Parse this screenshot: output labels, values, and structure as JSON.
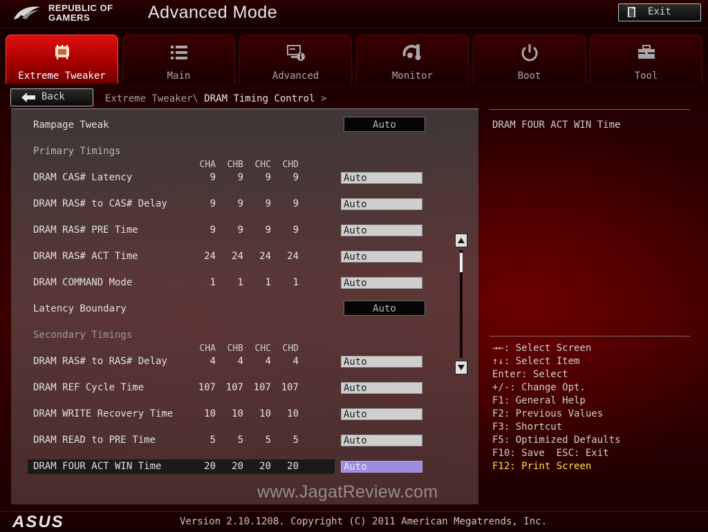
{
  "header": {
    "brand_line1": "REPUBLIC OF",
    "brand_line2": "GAMERS",
    "title": "Advanced Mode",
    "exit_label": "Exit"
  },
  "tabs": [
    {
      "label": "Extreme Tweaker",
      "icon": "extreme-tweaker-icon",
      "active": true
    },
    {
      "label": "Main",
      "icon": "list-icon",
      "active": false
    },
    {
      "label": "Advanced",
      "icon": "advanced-settings-icon",
      "active": false
    },
    {
      "label": "Monitor",
      "icon": "monitor-thermometer-icon",
      "active": false
    },
    {
      "label": "Boot",
      "icon": "power-icon",
      "active": false
    },
    {
      "label": "Tool",
      "icon": "toolbox-icon",
      "active": false
    }
  ],
  "nav": {
    "back_label": "Back",
    "breadcrumb_parent": "Extreme Tweaker\\",
    "breadcrumb_current": "DRAM Timing Control",
    "breadcrumb_arrow": ">"
  },
  "settings": {
    "rampage_tweak": {
      "label": "Rampage Tweak",
      "value": "Auto"
    },
    "primary_header": "Primary Timings",
    "channels": [
      "CHA",
      "CHB",
      "CHC",
      "CHD"
    ],
    "primary_rows": [
      {
        "label": "DRAM CAS# Latency",
        "values": [
          "9",
          "9",
          "9",
          "9"
        ],
        "setting": "Auto"
      },
      {
        "label": "DRAM RAS# to CAS# Delay",
        "values": [
          "9",
          "9",
          "9",
          "9"
        ],
        "setting": "Auto"
      },
      {
        "label": "DRAM RAS# PRE Time",
        "values": [
          "9",
          "9",
          "9",
          "9"
        ],
        "setting": "Auto"
      },
      {
        "label": "DRAM RAS# ACT Time",
        "values": [
          "24",
          "24",
          "24",
          "24"
        ],
        "setting": "Auto"
      },
      {
        "label": "DRAM COMMAND Mode",
        "values": [
          "1",
          "1",
          "1",
          "1"
        ],
        "setting": "Auto"
      }
    ],
    "latency_boundary": {
      "label": "Latency Boundary",
      "value": "Auto"
    },
    "secondary_header": "Secondary Timings",
    "secondary_rows": [
      {
        "label": "DRAM RAS# to RAS# Delay",
        "values": [
          "4",
          "4",
          "4",
          "4"
        ],
        "setting": "Auto"
      },
      {
        "label": "DRAM REF Cycle Time",
        "values": [
          "107",
          "107",
          "107",
          "107"
        ],
        "setting": "Auto"
      },
      {
        "label": "DRAM WRITE Recovery Time",
        "values": [
          "10",
          "10",
          "10",
          "10"
        ],
        "setting": "Auto"
      },
      {
        "label": "DRAM READ to PRE Time",
        "values": [
          "5",
          "5",
          "5",
          "5"
        ],
        "setting": "Auto"
      },
      {
        "label": "DRAM FOUR ACT WIN Time",
        "values": [
          "20",
          "20",
          "20",
          "20"
        ],
        "setting": "Auto",
        "selected": true
      }
    ]
  },
  "help": {
    "description": "DRAM FOUR ACT WIN Time",
    "keys": [
      "→←: Select Screen",
      "↑↓: Select Item",
      "Enter: Select",
      "+/-: Change Opt.",
      "F1: General Help",
      "F2: Previous Values",
      "F3: Shortcut",
      "F5: Optimized Defaults",
      "F10: Save  ESC: Exit",
      "F12: Print Screen"
    ]
  },
  "watermark": "www.JagatReview.com",
  "footer": {
    "logo": "ASUS",
    "version": "Version 2.10.1208. Copyright (C) 2011 American Megatrends, Inc."
  },
  "colors": {
    "accent_red": "#e01010",
    "selected_field": "#9c8ce0",
    "highlight_key": "#ffe14a"
  }
}
